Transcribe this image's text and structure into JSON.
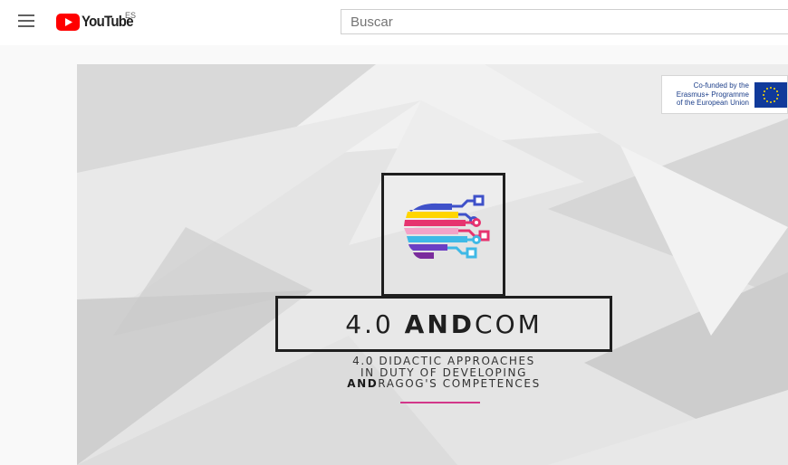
{
  "header": {
    "logo_text": "YouTube",
    "region_code": "ES",
    "search_placeholder": "Buscar"
  },
  "video": {
    "eu_badge_lines": [
      "Co-funded by the",
      "Erasmus+ Programme",
      "of the European Union"
    ],
    "title_prefix": "4.0 ",
    "title_bold": "AND",
    "title_suffix": "COM",
    "subtitle_line1": "4.0 DIDACTIC APPROACHES",
    "subtitle_line2": "IN DUTY OF DEVELOPING",
    "subtitle_line3_bold": "AND",
    "subtitle_line3_rest": "RAGOG'S COMPETENCES"
  },
  "colors": {
    "brand_red": "#ff0000",
    "accent_pink": "#d2378a",
    "eu_blue": "#103a9a",
    "eu_star": "#ffdd00"
  },
  "icons": [
    "menu-icon",
    "youtube-play-icon",
    "head-circuit-icon",
    "eu-flag-icon"
  ]
}
